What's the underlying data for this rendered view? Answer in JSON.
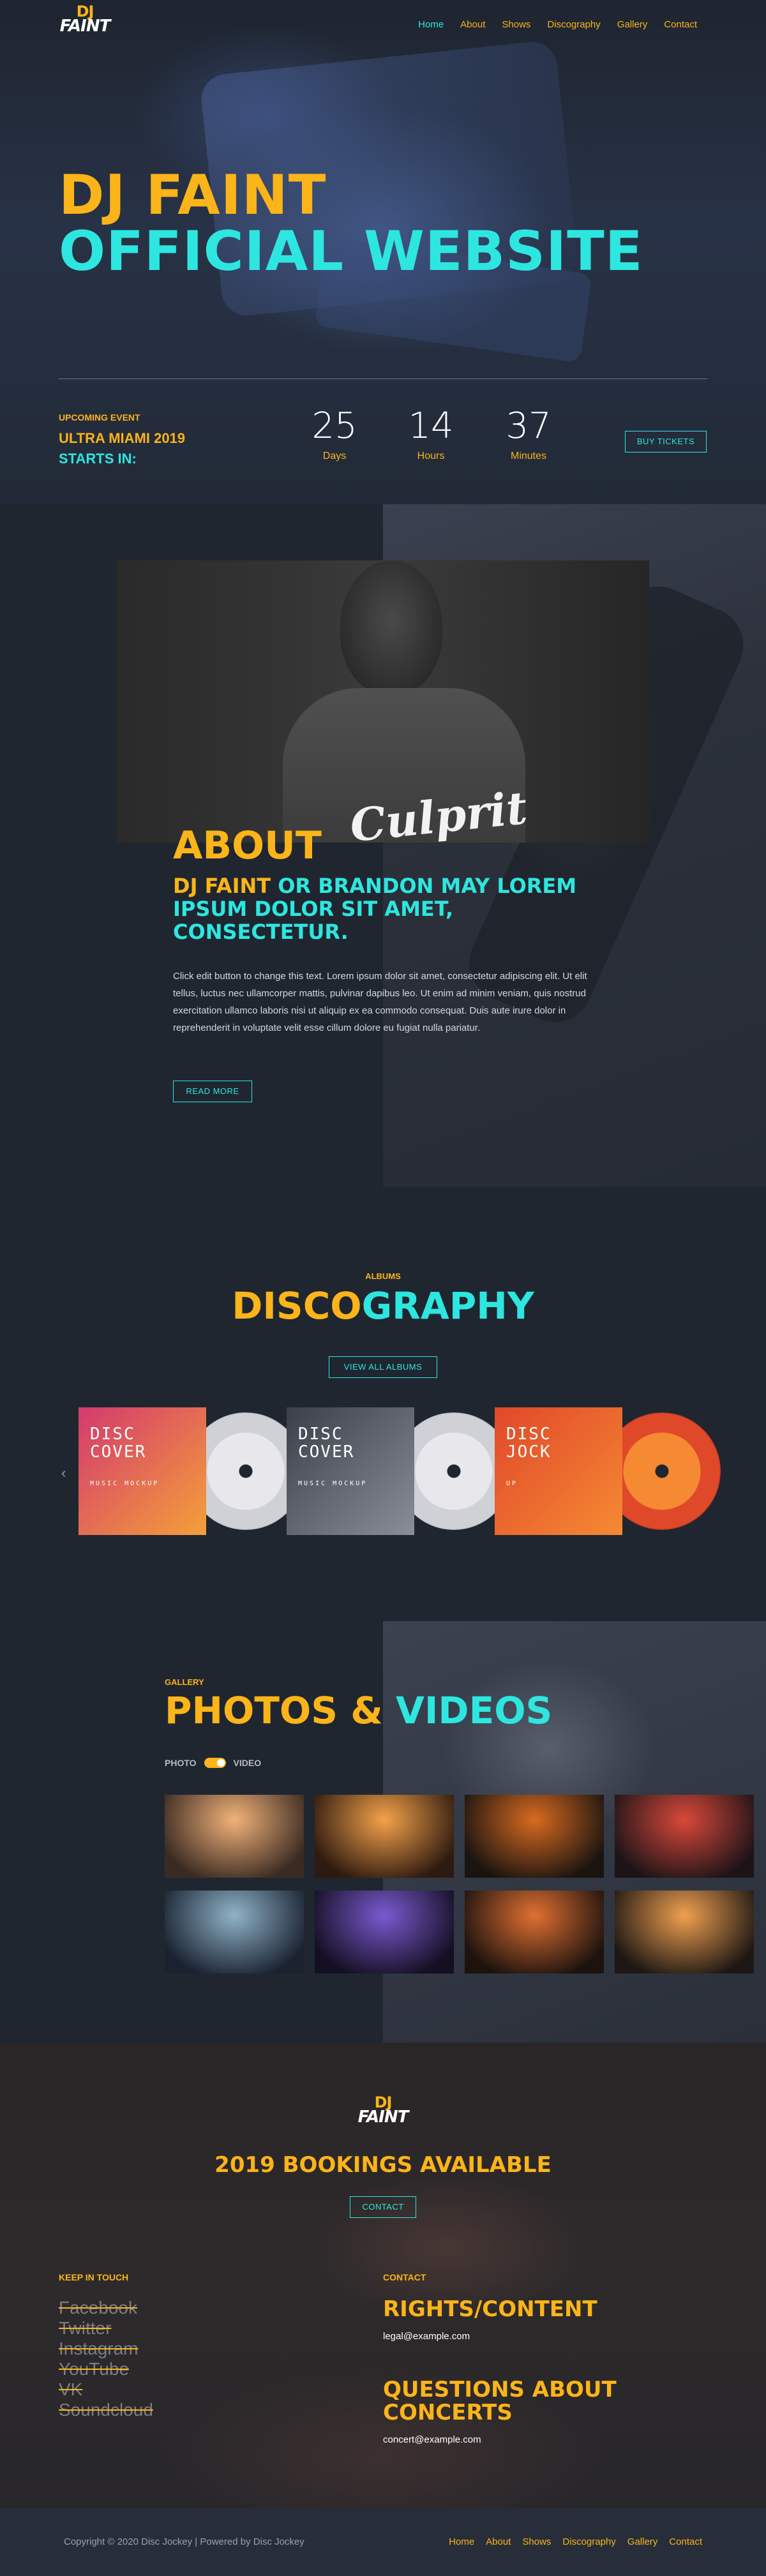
{
  "brand": {
    "logo_top": "DJ",
    "logo_bottom": "FAINT"
  },
  "nav": [
    "Home",
    "About",
    "Shows",
    "Discography",
    "Gallery",
    "Contact"
  ],
  "hero": {
    "title_line1": "DJ FAINT",
    "title_line2": "OFFICIAL WEBSITE",
    "event_label": "UPCOMING EVENT",
    "event_name": "ULTRA MIAMI 2019",
    "starts_in": "STARTS IN:",
    "countdown": [
      {
        "value": "25",
        "unit": "Days"
      },
      {
        "value": "14",
        "unit": "Hours"
      },
      {
        "value": "37",
        "unit": "Minutes"
      }
    ],
    "buy_button": "BUY TICKETS"
  },
  "about": {
    "shirt_text": "Culprit",
    "title": "ABOUT",
    "sub_yellow": "DJ FAINT",
    "sub_cyan": " OR BRANDON MAY LOREM IPSUM DOLOR SIT AMET, CONSECTETUR.",
    "body": "Click edit button to change this text. Lorem ipsum dolor sit amet, consectetur adipiscing elit. Ut elit tellus, luctus nec ullamcorper mattis, pulvinar dapibus leo. Ut enim ad minim veniam, quis nostrud exercitation ullamco laboris nisi ut aliquip ex ea commodo consequat. Duis aute irure dolor in reprehenderit in voluptate velit esse cillum dolore eu fugiat nulla pariatur.",
    "read_more": "READ MORE"
  },
  "discography": {
    "label": "ALBUMS",
    "title_yellow": "DISCO",
    "title_cyan": "GRAPHY",
    "view_all": "VIEW ALL ALBUMS",
    "albums": [
      {
        "line1": "DISC",
        "line2": "COVER",
        "line3": "MUSIC MOCKUP",
        "color1": "#d33a6e",
        "color2": "#f4a03a"
      },
      {
        "line1": "DISC",
        "line2": "COVER",
        "line3": "MUSIC MOCKUP",
        "color1": "#3a3f4a",
        "color2": "#8a8e98"
      },
      {
        "line1": "DISC",
        "line2": "JOCK",
        "line3": "UP",
        "color1": "#e0482a",
        "color2": "#f58a33"
      }
    ],
    "prev_arrow": "‹",
    "next_arrow": "›"
  },
  "gallery": {
    "label": "GALLERY",
    "title_yellow": "PHOTOS",
    "title_amp": " & ",
    "title_cyan": "VIDEOS",
    "toggle_left": "PHOTO",
    "toggle_right": "VIDEO",
    "photos": [
      {
        "c1": "#f2b27a",
        "c2": "#3a2a22"
      },
      {
        "c1": "#f4a24a",
        "c2": "#2e1a10"
      },
      {
        "c1": "#d86a20",
        "c2": "#1a1410"
      },
      {
        "c1": "#d9483a",
        "c2": "#1d1418"
      },
      {
        "c1": "#8fb3c8",
        "c2": "#1a2230"
      },
      {
        "c1": "#7a5ad0",
        "c2": "#140f22"
      },
      {
        "c1": "#e07032",
        "c2": "#1c120e"
      },
      {
        "c1": "#f0a050",
        "c2": "#1e1814"
      }
    ]
  },
  "bookings": {
    "title": "2019 BOOKINGS AVAILABLE",
    "contact_button": "CONTACT",
    "keep_in_touch": "KEEP IN TOUCH",
    "socials": [
      "Facebook",
      "Twitter",
      "Instagram",
      "YouTube",
      "VK",
      "Soundcloud"
    ],
    "contact_label": "CONTACT",
    "rights_title": "RIGHTS/CONTENT",
    "rights_email": "legal@example.com",
    "questions_title": "QUESTIONS ABOUT CONCERTS",
    "questions_email": "concert@example.com"
  },
  "footer": {
    "copyright": "Copyright © 2020 Disc Jockey | Powered by Disc Jockey",
    "nav": [
      "Home",
      "About",
      "Shows",
      "Discography",
      "Gallery",
      "Contact"
    ]
  },
  "colors": {
    "accent_yellow": "#fbb419",
    "accent_cyan": "#2ee6e0",
    "background": "#1f2630"
  }
}
